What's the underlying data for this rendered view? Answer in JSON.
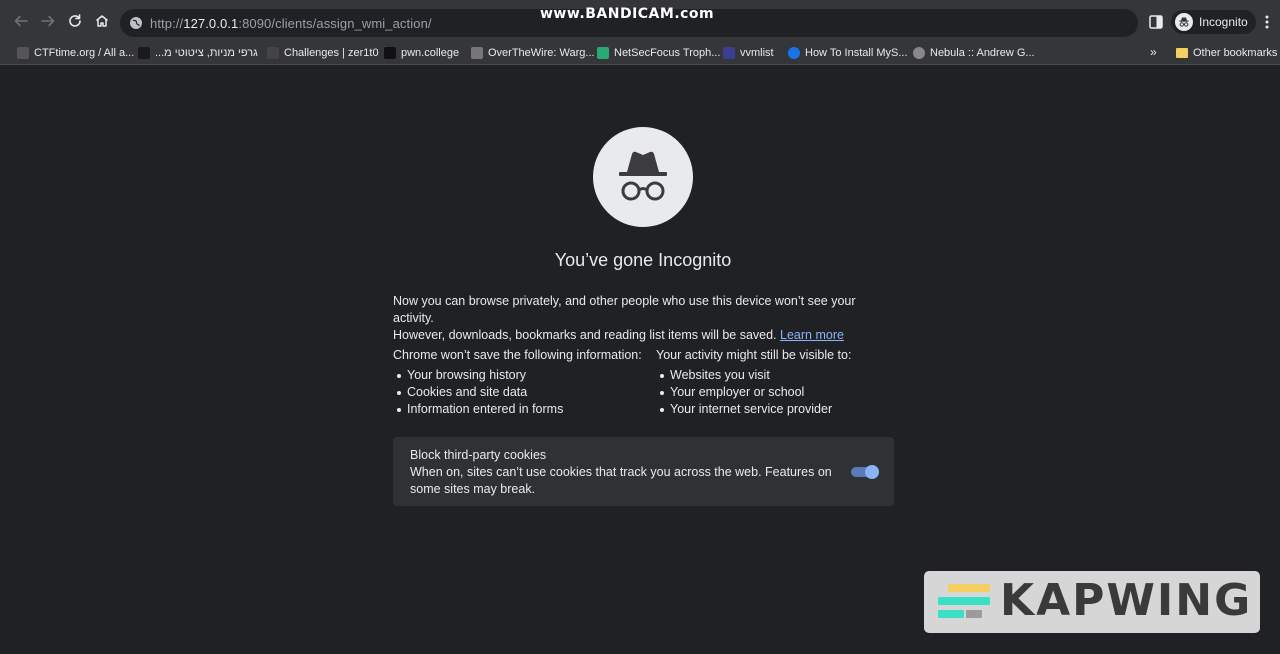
{
  "browser": {
    "url_scheme_path_prefix": "http://",
    "url_host": "127.0.0.1",
    "url_rest": ":8090/clients/assign_wmi_action/",
    "profile_label": "Incognito",
    "overlay_watermark": "www.BANDICAM.com"
  },
  "bookmarks": {
    "items": [
      {
        "label": "CTFtime.org / All a...",
        "color": "#555555"
      },
      {
        "label": "גרפי מניות, ציטוטי מ...",
        "color": "#1a1a1a"
      },
      {
        "label": "Challenges | zer1t0",
        "color": "#444444"
      },
      {
        "label": "pwn.college",
        "color": "#111111"
      },
      {
        "label": "OverTheWire: Warg...",
        "color": "#777777"
      },
      {
        "label": "NetSecFocus Troph...",
        "color": "#2aa876"
      },
      {
        "label": "vvmlist",
        "color": "#3b3f8f"
      },
      {
        "label": "How To Install MyS...",
        "color": "#1a73e8"
      },
      {
        "label": "Nebula :: Andrew G...",
        "color": "#888888"
      }
    ],
    "more": "»",
    "other_bookmarks": "Other bookmarks"
  },
  "page": {
    "title": "You’ve gone Incognito",
    "intro_line1": "Now you can browse privately, and other people who use this device won’t see your activity.",
    "intro_line2": "However, downloads, bookmarks and reading list items will be saved.",
    "learn_more": "Learn more",
    "left_column": {
      "title": "Chrome won’t save the following information:",
      "items": [
        "Your browsing history",
        "Cookies and site data",
        "Information entered in forms"
      ]
    },
    "right_column": {
      "title": "Your activity might still be visible to:",
      "items": [
        "Websites you visit",
        "Your employer or school",
        "Your internet service provider"
      ]
    },
    "cookies_card": {
      "title": "Block third-party cookies",
      "description": "When on, sites can’t use cookies that track you across the web. Features on some sites may break.",
      "toggle_on": true
    }
  },
  "watermark": {
    "text": "KAPWING",
    "bar_colors": [
      "#f4cf63",
      "#39e0c6",
      "#39e0c6",
      "#9b9b9b"
    ]
  }
}
